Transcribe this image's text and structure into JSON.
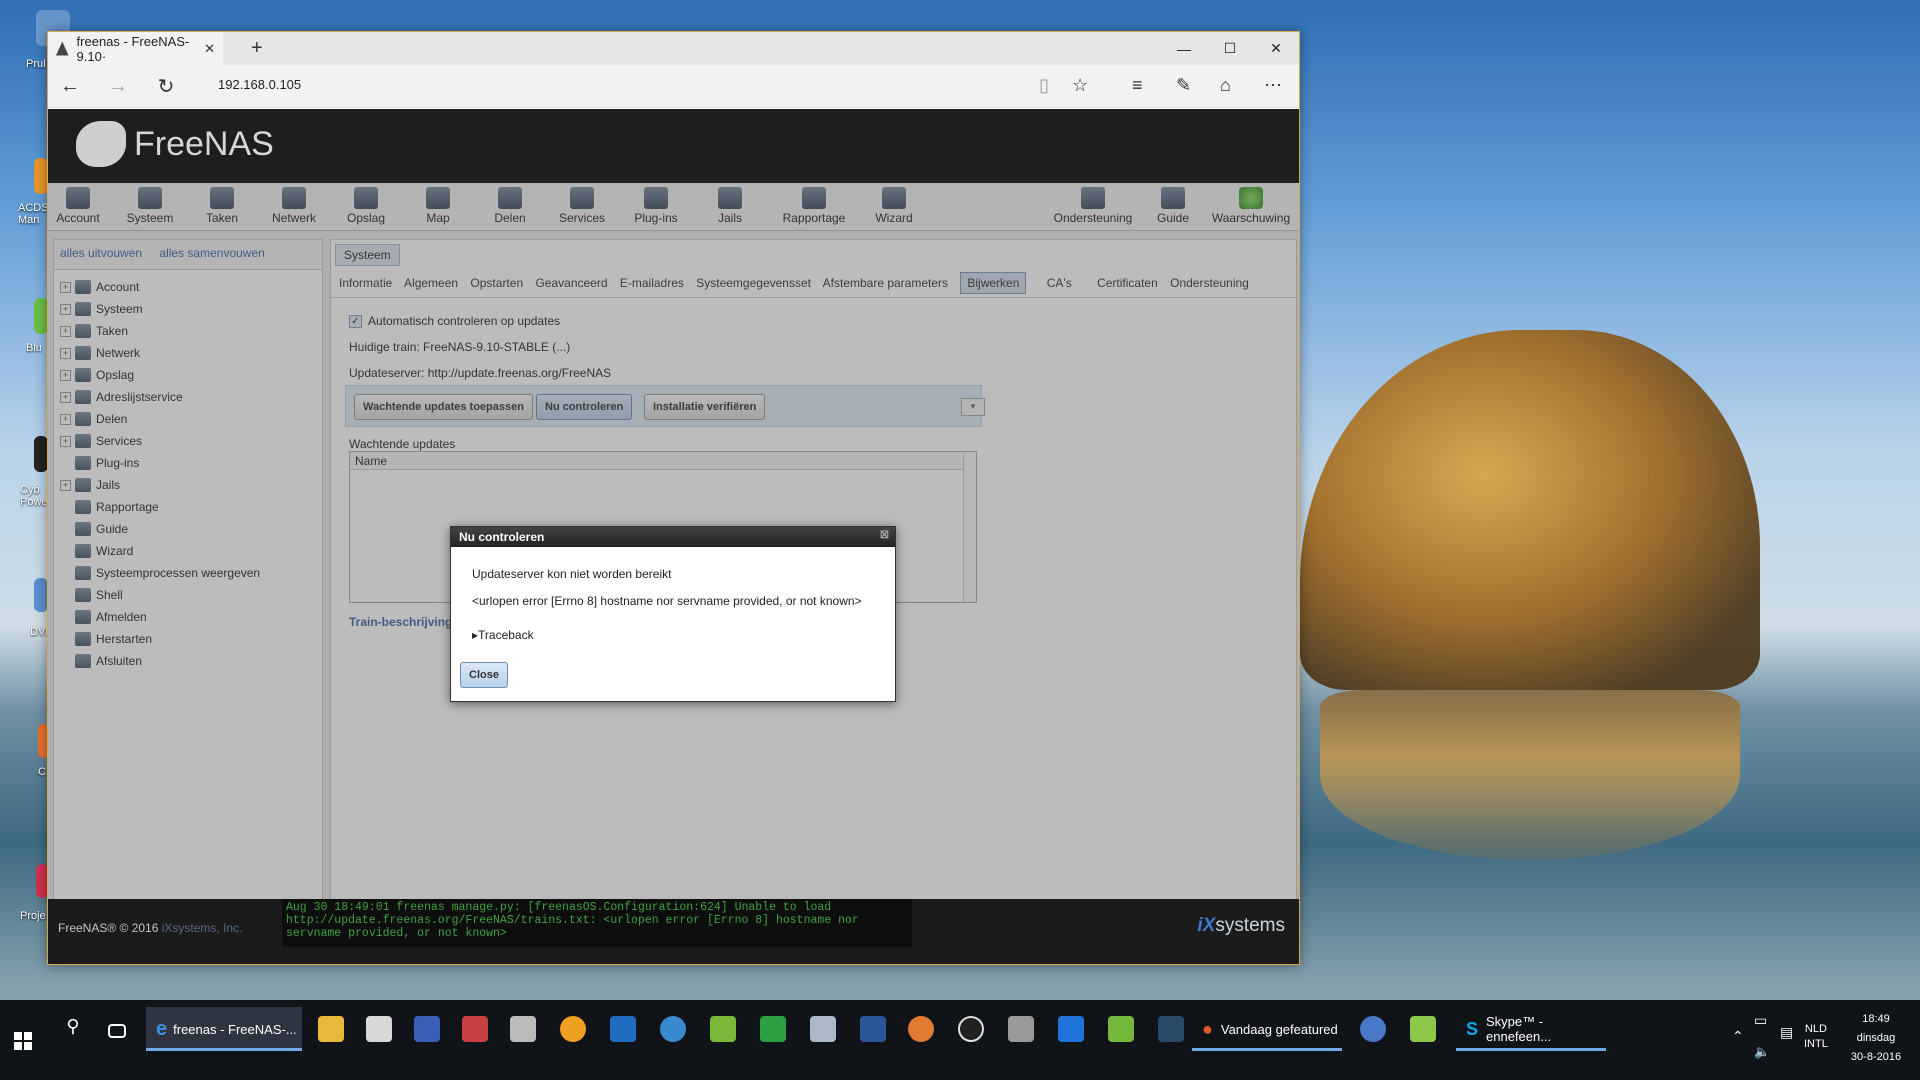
{
  "desktop": {
    "icons": [
      {
        "label": "Prul",
        "icon": "recycle-bin-icon"
      },
      {
        "label": "ACDS Man",
        "icon": "acdsee-icon"
      },
      {
        "label": "Blu",
        "icon": "bluestacks-icon"
      },
      {
        "label": "Cyb Powe",
        "icon": "cyberlink-icon"
      },
      {
        "label": "DVI",
        "icon": "dvd-icon"
      },
      {
        "label": "C",
        "icon": "app-icon"
      },
      {
        "label": "Proje",
        "icon": "project-icon"
      }
    ]
  },
  "browser": {
    "tab_title": "freenas - FreeNAS-9.10·",
    "tab_close": "✕",
    "new_tab": "+",
    "url": "192.168.0.105",
    "controls": {
      "minimize": "—",
      "maximize": "☐",
      "close": "✕"
    }
  },
  "freenas": {
    "logo_text": "FreeNAS",
    "toolbar": [
      {
        "label": "Account",
        "icon": "account-icon"
      },
      {
        "label": "Systeem",
        "icon": "system-icon"
      },
      {
        "label": "Taken",
        "icon": "tasks-icon"
      },
      {
        "label": "Netwerk",
        "icon": "network-icon"
      },
      {
        "label": "Opslag",
        "icon": "storage-icon"
      },
      {
        "label": "Map",
        "icon": "directory-icon"
      },
      {
        "label": "Delen",
        "icon": "sharing-icon"
      },
      {
        "label": "Services",
        "icon": "services-icon"
      },
      {
        "label": "Plug-ins",
        "icon": "plugins-icon"
      },
      {
        "label": "Jails",
        "icon": "jails-icon"
      },
      {
        "label": "Rapportage",
        "icon": "reporting-icon"
      },
      {
        "label": "Wizard",
        "icon": "wizard-icon"
      }
    ],
    "toolbar_right": [
      {
        "label": "Ondersteuning",
        "icon": "support-icon"
      },
      {
        "label": "Guide",
        "icon": "guide-icon"
      },
      {
        "label": "Waarschuwing",
        "icon": "alert-icon"
      }
    ],
    "sidebar": {
      "expand_all": "alles uitvouwen",
      "collapse_all": "alles samenvouwen",
      "items": [
        {
          "label": "Account",
          "expandable": true
        },
        {
          "label": "Systeem",
          "expandable": true
        },
        {
          "label": "Taken",
          "expandable": true
        },
        {
          "label": "Netwerk",
          "expandable": true
        },
        {
          "label": "Opslag",
          "expandable": true
        },
        {
          "label": "Adreslijstservice",
          "expandable": true
        },
        {
          "label": "Delen",
          "expandable": true
        },
        {
          "label": "Services",
          "expandable": true
        },
        {
          "label": "Plug-ins",
          "expandable": false
        },
        {
          "label": "Jails",
          "expandable": true
        },
        {
          "label": "Rapportage",
          "expandable": false
        },
        {
          "label": "Guide",
          "expandable": false
        },
        {
          "label": "Wizard",
          "expandable": false
        },
        {
          "label": "Systeemprocessen weergeven",
          "expandable": false
        },
        {
          "label": "Shell",
          "expandable": false
        },
        {
          "label": "Afmelden",
          "expandable": false
        },
        {
          "label": "Herstarten",
          "expandable": false
        },
        {
          "label": "Afsluiten",
          "expandable": false
        }
      ]
    },
    "main": {
      "tab": "Systeem",
      "subtabs": [
        "Informatie",
        "Algemeen",
        "Opstarten",
        "Geavanceerd",
        "E-mailadres",
        "Systeemgegevensset",
        "Afstembare parameters",
        "Bijwerken",
        "CA's",
        "Certificaten",
        "Ondersteuning"
      ],
      "active_subtab": "Bijwerken",
      "auto_check_label": "Automatisch controleren op updates",
      "auto_check_checked": true,
      "current_train": "Huidige train: FreeNAS-9.10-STABLE (...)",
      "update_server": "Updateserver: http://update.freenas.org/FreeNAS",
      "buttons": {
        "apply_pending": "Wachtende updates toepassen",
        "check_now": "Nu controleren",
        "verify_install": "Installatie verifiëren"
      },
      "pending_label": "Wachtende updates",
      "grid_header": "Name",
      "train_link": "Train-beschrijving"
    },
    "footer": {
      "copyright": "FreeNAS® © 2016",
      "company": "iXsystems, Inc.",
      "console": "Aug 30 18:49:01 freenas manage.py: [freenasOS.Configuration:624] Unable to load http://update.freenas.org/FreeNAS/trains.txt: <urlopen error [Errno 8] hostname nor servname provided, or not known>",
      "brand_ix": "iX",
      "brand_systems": "systems"
    },
    "dialog": {
      "title": "Nu controleren",
      "message": "Updateserver kon niet worden bereikt",
      "error": "<urlopen error [Errno 8] hostname nor servname provided, or not known>",
      "traceback": "Traceback",
      "close": "Close"
    }
  },
  "taskbar": {
    "active_app": "freenas - FreeNAS-...",
    "app2": "Vandaag gefeatured",
    "app3": "Skype™ - ennefeen...",
    "lang_top": "NLD",
    "lang_bottom": "INTL",
    "time": "18:49",
    "day": "dinsdag",
    "date": "30-8-2016"
  },
  "colors": {
    "accent": "#3566a8",
    "header_bg": "#1e1e1e",
    "console_green": "#3da33d",
    "taskbar_bg": "#101318"
  }
}
